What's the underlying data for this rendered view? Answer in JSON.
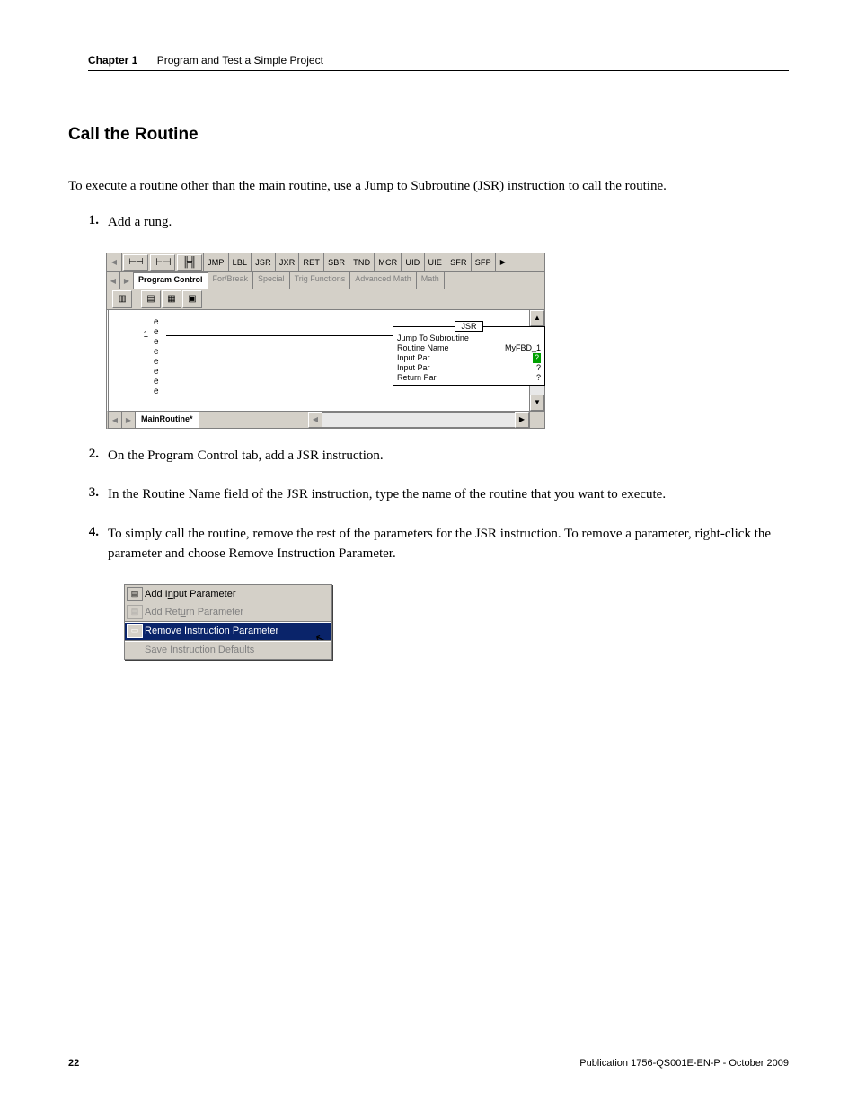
{
  "header": {
    "chapter": "Chapter 1",
    "title": "Program and Test a Simple Project"
  },
  "section_title": "Call the Routine",
  "intro": "To execute a routine other than the main routine, use a Jump to Subroutine (JSR) instruction to call the routine.",
  "steps": {
    "s1": {
      "num": "1.",
      "text": "Add a rung."
    },
    "s2": {
      "num": "2.",
      "text": "On the Program Control tab, add a JSR instruction."
    },
    "s3": {
      "num": "3.",
      "text": "In the Routine Name field of the JSR instruction, type the name of the routine that you want to execute."
    },
    "s4": {
      "num": "4.",
      "text": "To simply call the routine, remove the rest of the parameters for the JSR instruction. To remove a parameter, right-click the parameter and choose Remove Instruction Parameter."
    }
  },
  "editor": {
    "instructions": [
      "JMP",
      "LBL",
      "JSR",
      "JXR",
      "RET",
      "SBR",
      "TND",
      "MCR",
      "UID",
      "UIE",
      "SFR",
      "SFP"
    ],
    "tabs": [
      "Program Control",
      "For/Break",
      "Special",
      "Trig Functions",
      "Advanced Math",
      "Math"
    ],
    "rung_number": "1",
    "e_marks": "e\ne\ne\ne\ne\ne\ne\ne",
    "jsr": {
      "title": "JSR",
      "line1": "Jump To Subroutine",
      "routine_label": "Routine Name",
      "routine_value": "MyFBD_1",
      "rows": [
        {
          "label": "Input Par",
          "val": "?"
        },
        {
          "label": "Input Par",
          "val": "?"
        },
        {
          "label": "Return Par",
          "val": "?"
        }
      ]
    },
    "routine_tab": "MainRoutine*"
  },
  "context_menu": {
    "items": [
      {
        "label_pre": "Add I",
        "label_u": "n",
        "label_post": "put Parameter",
        "enabled": true,
        "icon": "add-input-icon"
      },
      {
        "label_pre": "Add Ret",
        "label_u": "u",
        "label_post": "rn Parameter",
        "enabled": false,
        "icon": "add-return-icon"
      },
      {
        "label_pre": "",
        "label_u": "R",
        "label_post": "emove Instruction Parameter",
        "enabled": true,
        "icon": "remove-param-icon",
        "hover": true,
        "sep": true
      },
      {
        "label_pre": "Save Instruction Defaults",
        "label_u": "",
        "label_post": "",
        "enabled": false,
        "icon": "",
        "sep": true
      }
    ]
  },
  "footer": {
    "page": "22",
    "pub": "Publication 1756-QS001E-EN-P - October 2009"
  }
}
